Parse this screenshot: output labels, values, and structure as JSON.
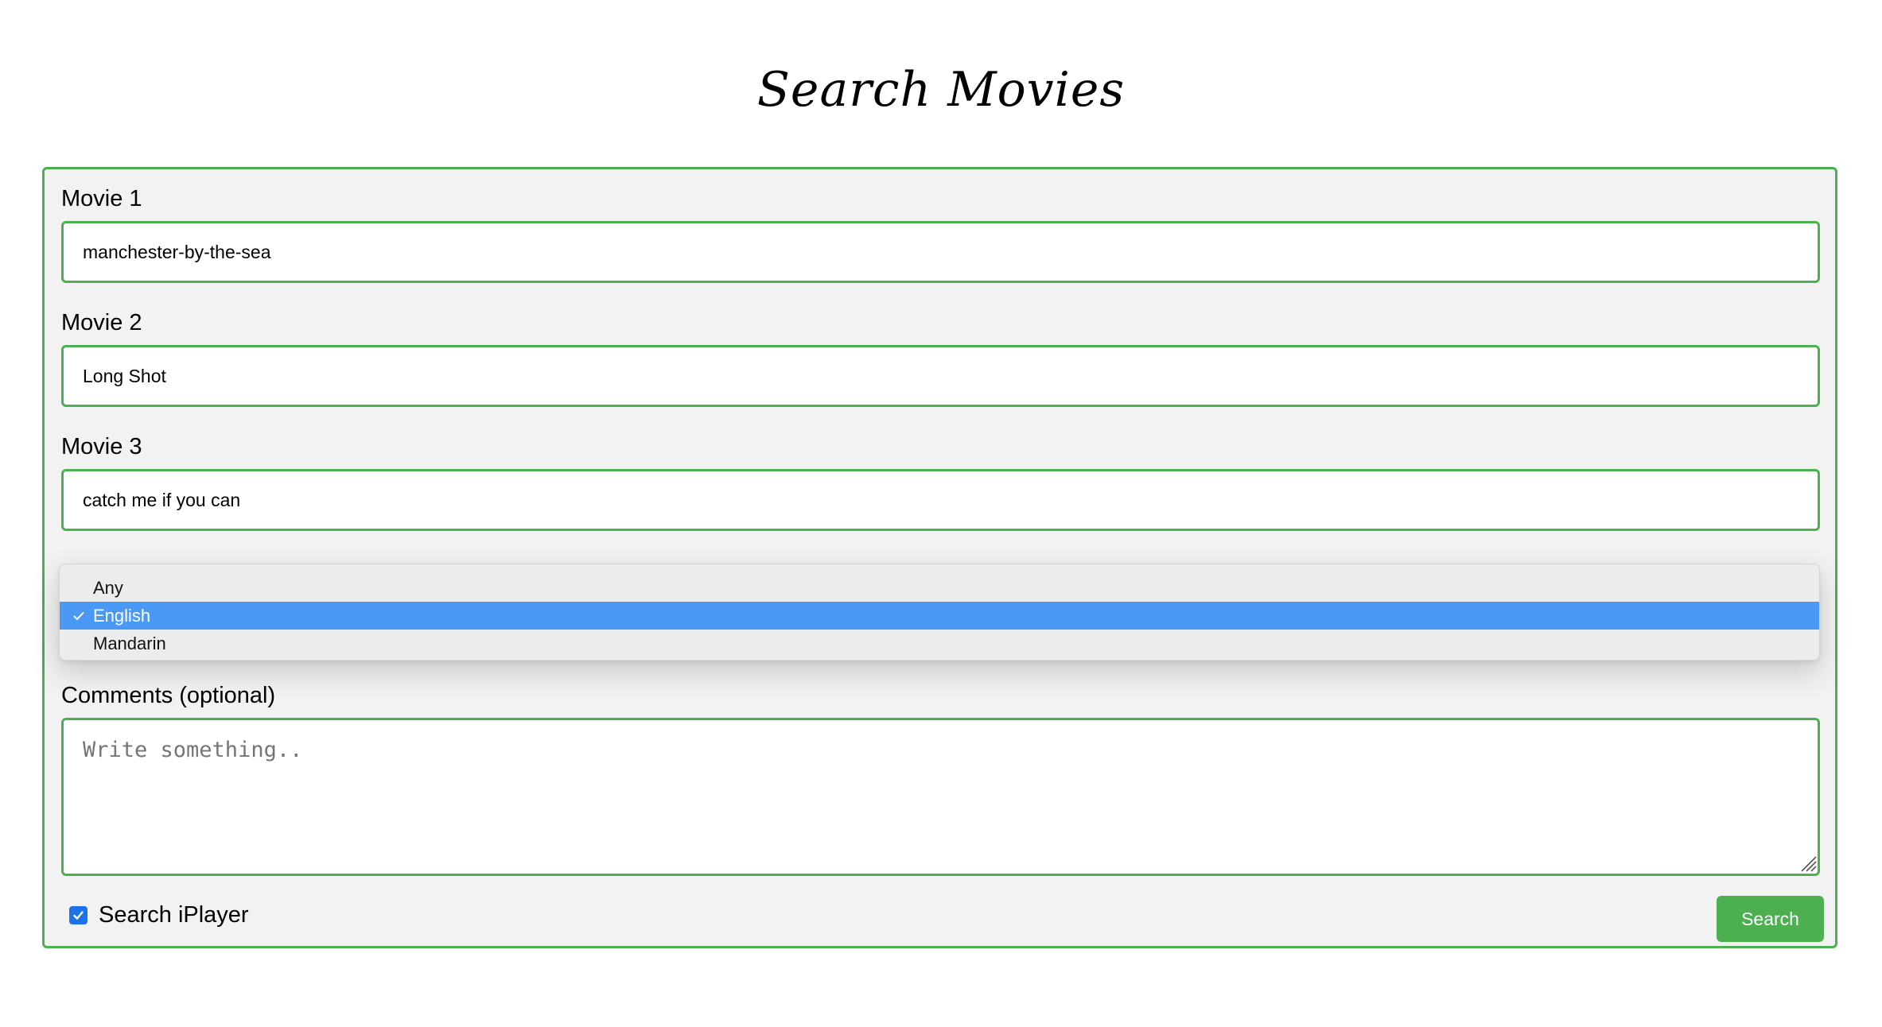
{
  "page": {
    "title": "Search Movies"
  },
  "form": {
    "movie1": {
      "label": "Movie 1",
      "value": "manchester-by-the-sea"
    },
    "movie2": {
      "label": "Movie 2",
      "value": "Long Shot"
    },
    "movie3": {
      "label": "Movie 3",
      "value": "catch me if you can"
    },
    "language": {
      "selected": "English",
      "options": [
        "Any",
        "English",
        "Mandarin"
      ]
    },
    "comments": {
      "label": "Comments (optional)",
      "placeholder": "Write something..",
      "value": ""
    },
    "iplayer": {
      "label": "Search iPlayer",
      "checked": true
    },
    "submit_label": "Search"
  },
  "colors": {
    "accent_green": "#4caf50",
    "form_background": "#f2f2f2",
    "dropdown_highlight": "#4a9af5",
    "checkbox_blue": "#1a73e8"
  },
  "icons": {
    "selected_option": "checkmark-icon",
    "checkbox": "checkbox-checked-icon",
    "textarea_resize": "resize-grip-icon"
  }
}
